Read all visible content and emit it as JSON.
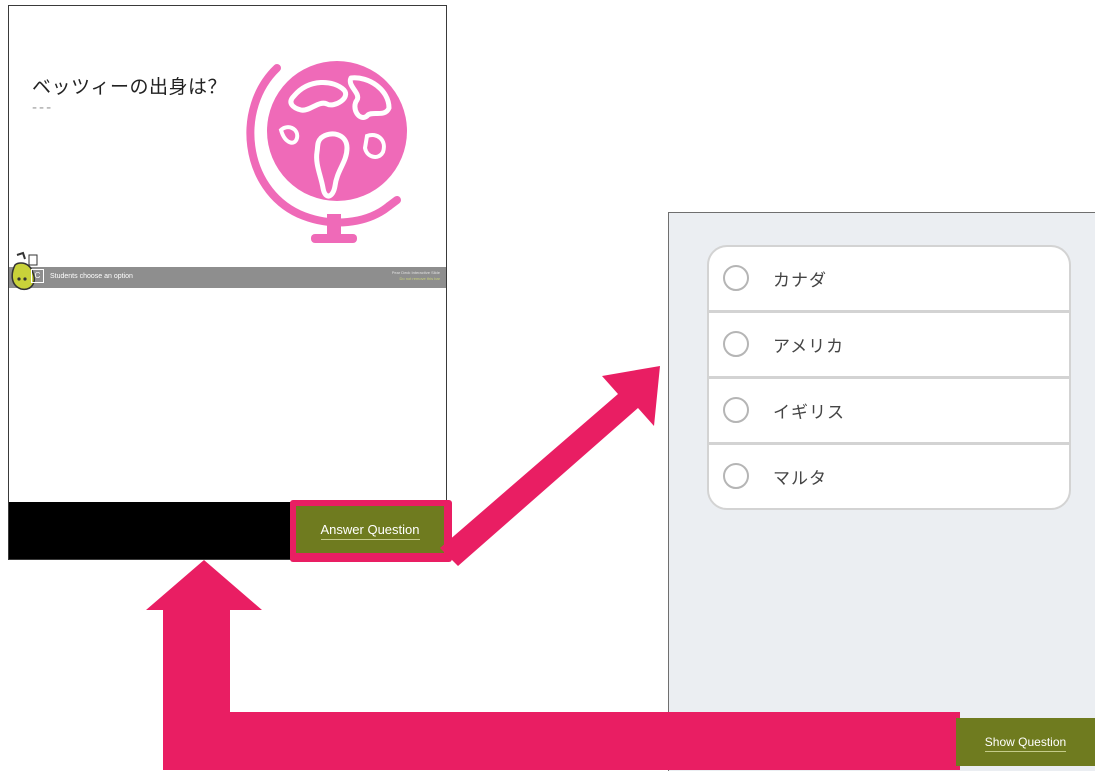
{
  "slide": {
    "question": "ベッツィーの出身は？",
    "answer_placeholder": "---",
    "instruction_badge": "C",
    "instruction": "Students choose an option",
    "peardeck_line1": "Pear Deck Interactive Slide",
    "peardeck_line2": "Do not remove this bar",
    "answer_button": "Answer Question"
  },
  "options": {
    "items": [
      {
        "label": "カナダ"
      },
      {
        "label": "アメリカ"
      },
      {
        "label": "イギリス"
      },
      {
        "label": "マルタ"
      }
    ],
    "show_button": "Show Question"
  },
  "colors": {
    "accent": "#e91e63",
    "button_olive": "#6f7b1f",
    "globe_pink": "#ef6ab8",
    "panel_bg": "#ebeef2"
  },
  "icons": [
    "pear-logo-icon",
    "globe-illustration",
    "radio-icon",
    "arrow-icon"
  ]
}
